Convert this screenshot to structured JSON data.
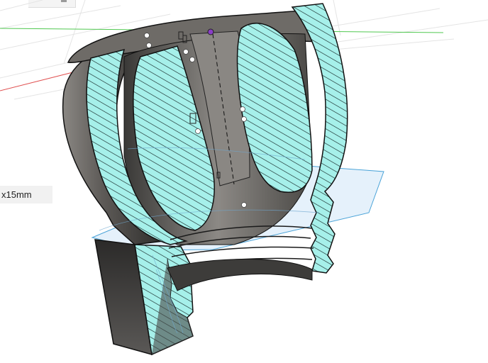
{
  "viewport": {
    "dimension_label": "x15mm"
  },
  "colors": {
    "section_fill": "#a6f0ea",
    "body_shell": "#5e5b58",
    "body_dark": "#2f2e2c",
    "plane_fill": "#cfe6f8",
    "plane_edge": "#4aa3d8",
    "axis_x": "#e04848",
    "axis_y": "#47c447",
    "background": "#ffffff"
  }
}
